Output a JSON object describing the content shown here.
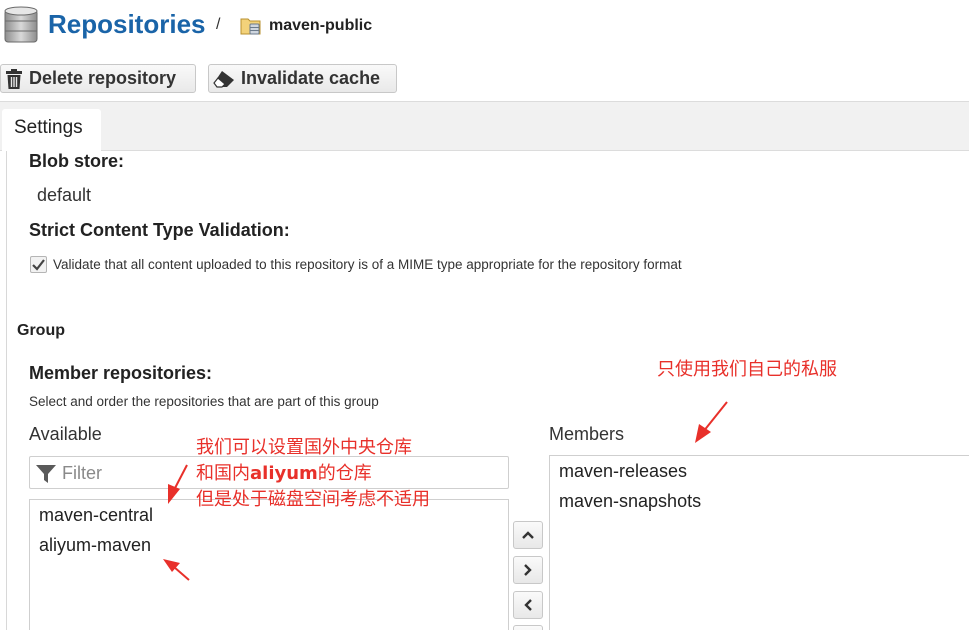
{
  "header": {
    "title": "Repositories",
    "separator": "/",
    "breadcrumb": "maven-public"
  },
  "toolbar": {
    "delete_label": "Delete repository",
    "invalidate_label": "Invalidate cache"
  },
  "tabs": [
    {
      "label": "Settings",
      "active": true
    }
  ],
  "settings": {
    "blob_store_label": "Blob store:",
    "blob_store_value": "default",
    "strict_label": "Strict Content Type Validation:",
    "strict_checkbox_text": "Validate that all content uploaded to this repository is of a MIME type appropriate for the repository format",
    "strict_checked": true
  },
  "group": {
    "section_label": "Group",
    "member_label": "Member repositories:",
    "member_help": "Select and order the repositories that are part of this group",
    "available_label": "Available",
    "filter_placeholder": "Filter",
    "available_items": [
      "maven-central",
      "aliyum-maven"
    ],
    "members_label": "Members",
    "member_items": [
      "maven-releases",
      "maven-snapshots"
    ]
  },
  "annotations": {
    "note_private": "只使用我们自己的私服",
    "note_line1": "我们可以设置国外中央仓库",
    "note_line2_pre": "和国内",
    "note_line2_bold": "aliyum",
    "note_line2_post": "的仓库",
    "note_line3": "但是处于磁盘空间考虑不适用",
    "color": "#e8302a"
  },
  "colors": {
    "brand_blue": "#1a64a8",
    "tab_bar_bg": "#f1f1f1"
  },
  "icons": [
    "database-icon",
    "repository-group-icon",
    "trash-icon",
    "eraser-icon",
    "checkmark-icon",
    "filter-icon",
    "chevron-up-icon",
    "chevron-right-icon",
    "chevron-left-icon"
  ]
}
